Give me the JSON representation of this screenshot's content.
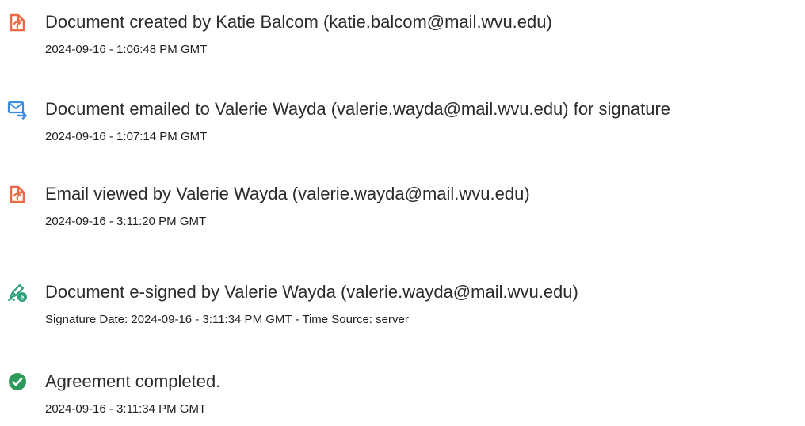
{
  "events": [
    {
      "icon": "document-created-icon",
      "title": "Document created by Katie Balcom (katie.balcom@mail.wvu.edu)",
      "timestamp": "2024-09-16 - 1:06:48 PM GMT"
    },
    {
      "icon": "email-sent-icon",
      "title": "Document emailed to Valerie Wayda (valerie.wayda@mail.wvu.edu) for signature",
      "timestamp": "2024-09-16 - 1:07:14 PM GMT"
    },
    {
      "icon": "email-viewed-icon",
      "title": "Email viewed by Valerie Wayda (valerie.wayda@mail.wvu.edu)",
      "timestamp": "2024-09-16 - 3:11:20 PM GMT"
    },
    {
      "icon": "e-sign-pen-icon",
      "title": "Document e-signed by Valerie Wayda (valerie.wayda@mail.wvu.edu)",
      "timestamp": "Signature Date: 2024-09-16 - 3:11:34 PM GMT - Time Source: server"
    },
    {
      "icon": "check-circle-icon",
      "title": "Agreement completed.",
      "timestamp": "2024-09-16 - 3:11:34 PM GMT"
    }
  ],
  "colors": {
    "adobe_orange": "#EB6A45",
    "email_blue": "#3A8DDE",
    "sign_green": "#2DA17A",
    "complete_green": "#2D9A5C"
  }
}
